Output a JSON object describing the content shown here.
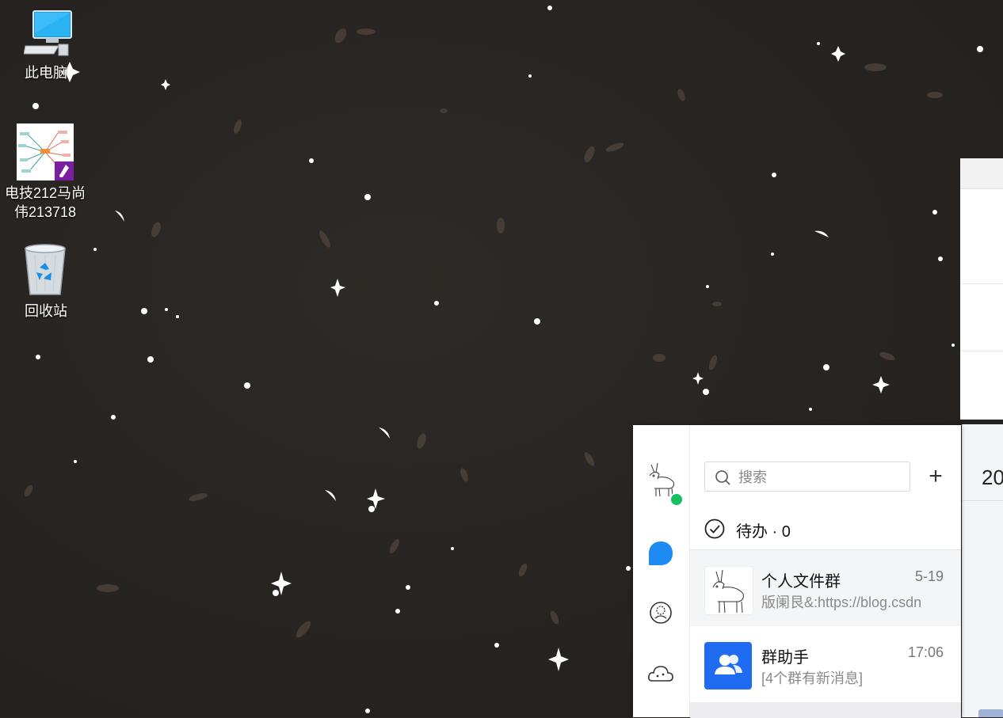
{
  "desktop": {
    "icons": [
      {
        "label": "此电脑",
        "icon": "computer-icon"
      },
      {
        "label": "电技212马尚伟213718",
        "icon": "mindmap-file-icon"
      },
      {
        "label": "回收站",
        "icon": "recycle-bin-icon"
      }
    ]
  },
  "background_window": {
    "partial_text": "20"
  },
  "chat_window": {
    "search": {
      "placeholder": "搜索"
    },
    "add_label": "+",
    "todo_label": "待办 · 0",
    "conversations": [
      {
        "name": "个人文件群",
        "time": "5-19",
        "message": "版阑艮&:https://blog.csdn",
        "avatar": "deer-sketch-avatar"
      },
      {
        "name": "群助手",
        "time": "17:06",
        "message": "[4个群有新消息]",
        "avatar": "group-assistant-icon"
      }
    ],
    "nav": [
      "chat-icon",
      "contacts-icon",
      "space-icon"
    ],
    "colors": {
      "accent": "#1d8bf1",
      "online": "#16c060",
      "group_icon_bg": "#1f6cf2"
    }
  }
}
